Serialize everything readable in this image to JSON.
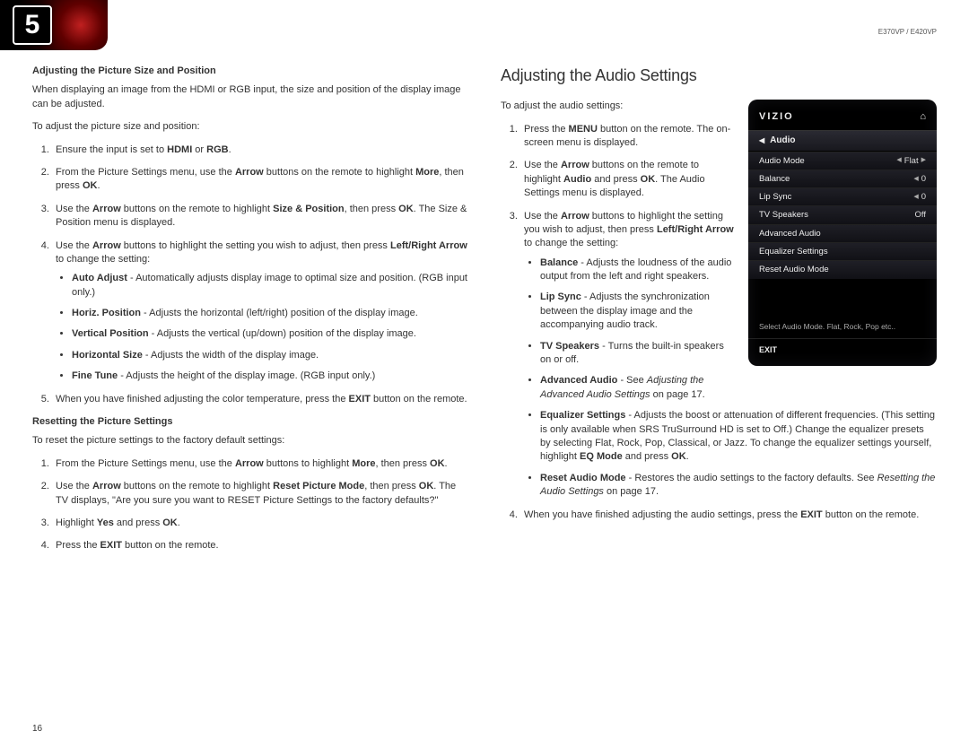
{
  "header": {
    "chapter_number": "5",
    "model_id": "E370VP / E420VP"
  },
  "page_number": "16",
  "left": {
    "h1": "Adjusting the Picture Size and Position",
    "intro": "When displaying an image from the HDMI or RGB input, the size and position of the display image can be adjusted.",
    "lead": "To adjust the picture size and position:",
    "li1a": "Ensure the input is set to ",
    "li1b": "HDMI",
    "li1c": " or ",
    "li1d": "RGB",
    "li1e": ".",
    "li2a": "From the Picture Settings menu, use the ",
    "li2b": "Arrow",
    "li2c": " buttons on the remote to highlight ",
    "li2d": "More",
    "li2e": ", then press ",
    "li2f": "OK",
    "li2g": ".",
    "li3a": "Use the ",
    "li3b": "Arrow",
    "li3c": " buttons on the remote to highlight ",
    "li3d": "Size & Position",
    "li3e": ", then press ",
    "li3f": "OK",
    "li3g": ". The Size & Position menu is displayed.",
    "li4a": "Use the ",
    "li4b": "Arrow",
    "li4c": " buttons to highlight the setting you wish to adjust, then press ",
    "li4d": "Left/Right Arrow",
    "li4e": " to change the setting:",
    "b1n": "Auto Adjust",
    "b1t": " - Automatically adjusts display image to optimal size and position. (RGB input only.)",
    "b2n": "Horiz. Position",
    "b2t": " - Adjusts the horizontal (left/right) position of the display image.",
    "b3n": "Vertical Position",
    "b3t": " - Adjusts the vertical (up/down) position of the display image.",
    "b4n": "Horizontal Size",
    "b4t": " - Adjusts the width of the display image.",
    "b5n": "Fine Tune",
    "b5t": " - Adjusts the height of the display image. (RGB input only.)",
    "li5a": "When you have finished adjusting the color temperature, press the ",
    "li5b": "EXIT",
    "li5c": " button on the remote.",
    "h2": "Resetting the Picture Settings",
    "reset_lead": "To reset the picture settings to the factory default settings:",
    "r1a": "From the Picture Settings menu, use the ",
    "r1b": "Arrow",
    "r1c": " buttons to highlight ",
    "r1d": "More",
    "r1e": ", then press ",
    "r1f": "OK",
    "r1g": ".",
    "r2a": "Use the ",
    "r2b": "Arrow",
    "r2c": " buttons on the remote to highlight ",
    "r2d": "Reset Picture Mode",
    "r2e": ", then press ",
    "r2f": "OK",
    "r2g": ". The TV displays, \"Are you sure you want to RESET Picture Settings to the factory defaults?\"",
    "r3a": "Highlight ",
    "r3b": "Yes",
    "r3c": " and press ",
    "r3d": "OK",
    "r3e": ".",
    "r4a": "Press the ",
    "r4b": "EXIT",
    "r4c": " button on the remote."
  },
  "right": {
    "title": "Adjusting the Audio Settings",
    "lead": "To adjust the audio settings:",
    "li1a": "Press the ",
    "li1b": "MENU",
    "li1c": " button on the remote. The on-screen menu is displayed.",
    "li2a": "Use the ",
    "li2b": "Arrow",
    "li2c": " buttons on the remote to highlight ",
    "li2d": "Audio",
    "li2e": " and press ",
    "li2f": "OK",
    "li2g": ". The Audio Settings menu is displayed.",
    "li3a": "Use the ",
    "li3b": "Arrow",
    "li3c": " buttons to highlight the setting you wish to adjust, then press ",
    "li3d": "Left/Right Arrow",
    "li3e": " to change the setting:",
    "b1n": "Balance",
    "b1t": " - Adjusts the loudness of the audio output from the left and right speakers.",
    "b2n": "Lip Sync",
    "b2t": " - Adjusts the synchronization between the display image and the accompanying audio track.",
    "b3n": "TV Speakers",
    "b3t": " - Turns the built-in speakers on or off.",
    "b4n": "Advanced Audio",
    "b4t1": " - See ",
    "b4t2": "Adjusting the Advanced Audio Settings",
    "b4t3": " on page 17.",
    "b5n": "Equalizer Settings",
    "b5t1": " - Adjusts the boost or attenuation of different frequencies. (This setting is only available when SRS TruSurround HD is set to Off.) Change the equalizer presets by selecting Flat, Rock, Pop, Classical, or Jazz. To change the equalizer settings yourself, highlight ",
    "b5t2": "EQ Mode",
    "b5t3": " and press ",
    "b5t4": "OK",
    "b5t5": ".",
    "b6n": "Reset Audio Mode",
    "b6t1": " - Restores the audio settings to the factory defaults. See ",
    "b6t2": "Resetting the Audio Settings",
    "b6t3": " on page 17.",
    "li4a": "When you have finished adjusting the audio settings, press the ",
    "li4b": "EXIT",
    "li4c": " button on the remote."
  },
  "tv": {
    "brand": "VIZIO",
    "home_icon": "⌂",
    "menu_title": "Audio",
    "rows": {
      "audio_mode_label": "Audio Mode",
      "audio_mode_value": "Flat",
      "balance_label": "Balance",
      "balance_value": "0",
      "lipsync_label": "Lip Sync",
      "lipsync_value": "0",
      "tvspk_label": "TV Speakers",
      "tvspk_value": "Off",
      "adv_label": "Advanced Audio",
      "eq_label": "Equalizer Settings",
      "reset_label": "Reset Audio Mode"
    },
    "hint": "Select Audio Mode. Flat, Rock, Pop etc..",
    "exit": "EXIT"
  }
}
